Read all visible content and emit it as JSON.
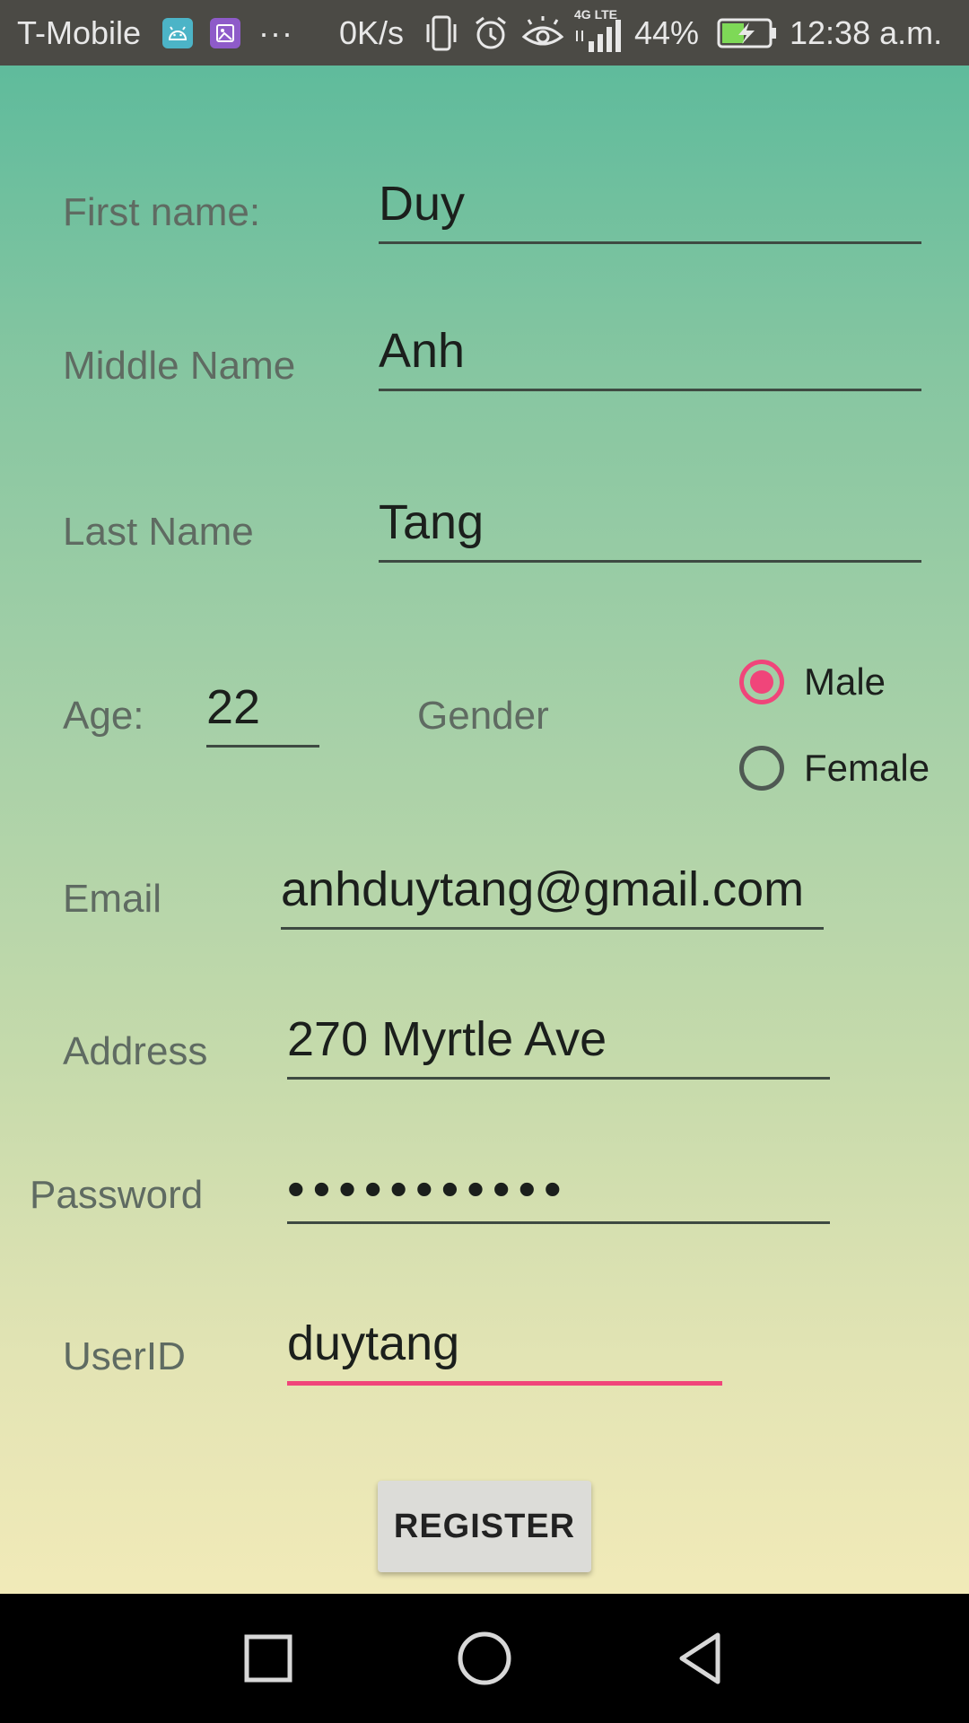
{
  "status_bar": {
    "carrier": "T-Mobile",
    "overflow": "···",
    "net_speed": "0K/s",
    "network": "4G LTE",
    "battery_percent": "44%",
    "time": "12:38 a.m.",
    "icons": [
      "android-icon",
      "gallery-icon",
      "vibrate-icon",
      "alarm-icon",
      "eye-icon",
      "signal-icon",
      "battery-charging-icon"
    ]
  },
  "form": {
    "first_name": {
      "label": "First name:",
      "value": "Duy"
    },
    "middle_name": {
      "label": "Middle Name",
      "value": "Anh"
    },
    "last_name": {
      "label": "Last Name",
      "value": "Tang"
    },
    "age": {
      "label": "Age:",
      "value": "22"
    },
    "gender": {
      "label": "Gender",
      "options": [
        {
          "label": "Male",
          "selected": true
        },
        {
          "label": "Female",
          "selected": false
        }
      ]
    },
    "email": {
      "label": "Email",
      "value": "anhduytang@gmail.com"
    },
    "address": {
      "label": "Address",
      "value": "270 Myrtle Ave"
    },
    "password": {
      "label": "Password",
      "value": "•••••••••••"
    },
    "user_id": {
      "label": "UserID",
      "value": "duytang"
    },
    "register_label": "REGISTER"
  },
  "nav_bar": {
    "icons": [
      "recents-square-icon",
      "home-circle-icon",
      "back-triangle-icon"
    ]
  },
  "colors": {
    "accent": "#f0457a",
    "status_bar": "#4b4a45",
    "nav_bar": "#000000"
  }
}
